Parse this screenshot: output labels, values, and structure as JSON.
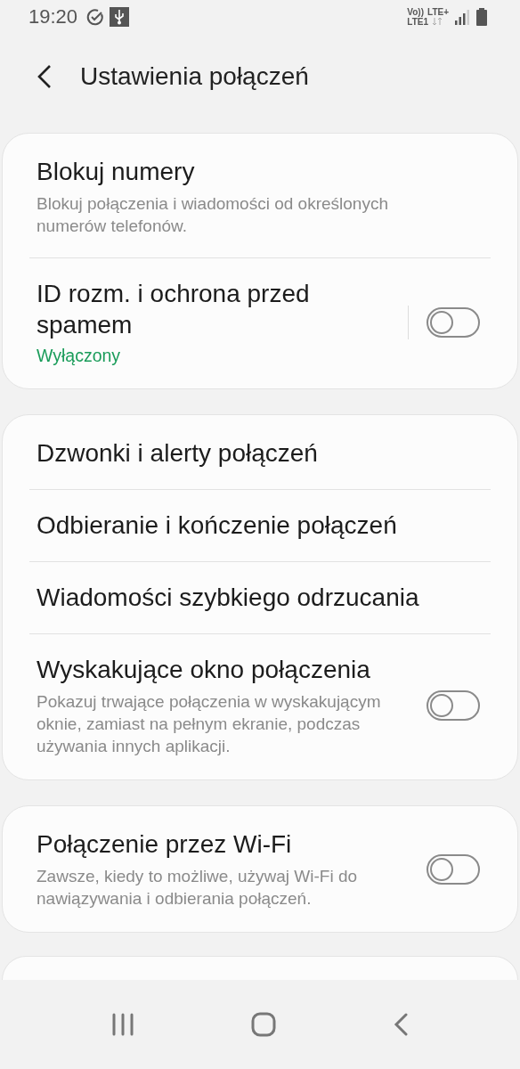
{
  "status_bar": {
    "time": "19:20",
    "network_top": "Vo))",
    "network_type": "LTE+",
    "sim": "LTE1"
  },
  "header": {
    "title": "Ustawienia połączeń"
  },
  "groups": [
    {
      "items": [
        {
          "kind": "link",
          "title": "Blokuj numery",
          "subtitle": "Blokuj połączenia i wiadomości od określonych numerów telefonów."
        },
        {
          "kind": "toggle",
          "title": "ID rozm. i ochrona przed spamem",
          "status": "Wyłączony",
          "on": false,
          "split": true
        }
      ]
    },
    {
      "items": [
        {
          "kind": "link",
          "title": "Dzwonki i alerty połączeń"
        },
        {
          "kind": "link",
          "title": "Odbieranie i kończenie połączeń"
        },
        {
          "kind": "link",
          "title": "Wiadomości szybkiego odrzucania"
        },
        {
          "kind": "toggle",
          "title": "Wyskakujące okno połączenia",
          "subtitle": "Pokazuj trwające połączenia w wyskakującym oknie, zamiast na pełnym ekranie, podczas używania innych aplikacji.",
          "on": false
        }
      ]
    },
    {
      "items": [
        {
          "kind": "toggle",
          "title": "Połączenie przez Wi-Fi",
          "subtitle": "Zawsze, kiedy to możliwe, używaj Wi-Fi do nawiązywania i odbierania połączeń.",
          "on": false
        }
      ]
    }
  ]
}
